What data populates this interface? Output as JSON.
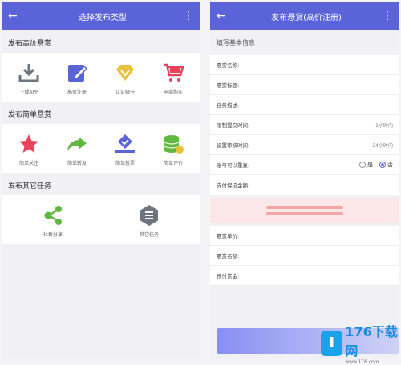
{
  "left": {
    "title": "选择发布类型",
    "sections": [
      {
        "title": "发布高价悬赏",
        "items": [
          {
            "label": "下载APP",
            "icon": "download-icon"
          },
          {
            "label": "高价注册",
            "icon": "edit-icon"
          },
          {
            "label": "认证绑卡",
            "icon": "diamond-icon"
          },
          {
            "label": "电商购买",
            "icon": "cart-icon"
          }
        ]
      },
      {
        "title": "发布简单悬赏",
        "items": [
          {
            "label": "简单关注",
            "icon": "star-icon"
          },
          {
            "label": "简单转发",
            "icon": "share-arrow-icon"
          },
          {
            "label": "简单投票",
            "icon": "vote-icon"
          },
          {
            "label": "简单评价",
            "icon": "database-icon"
          }
        ]
      },
      {
        "title": "发布其它任务",
        "items": [
          {
            "label": "社群分享",
            "icon": "share-nodes-icon"
          },
          {
            "label": "其它任务",
            "icon": "list-icon"
          }
        ]
      }
    ]
  },
  "right": {
    "title": "发布悬赏(高价注册)",
    "section_title": "填写基本信息",
    "fields": [
      {
        "label": "悬赏名称:"
      },
      {
        "label": "悬赏标题:"
      },
      {
        "label": "任务描述:"
      },
      {
        "label": "限制提交时间:",
        "value": "1小时内"
      },
      {
        "label": "设置审核时间:",
        "value": "24小时内"
      },
      {
        "label": "账号可以重复:"
      },
      {
        "label": "支付保证金额:"
      }
    ],
    "radio": {
      "yes": "是",
      "no": "否"
    },
    "fields2": [
      {
        "label": "悬赏单价:"
      },
      {
        "label": "悬赏名额:"
      },
      {
        "label": "预付赏金:"
      }
    ]
  },
  "watermark": {
    "logo": "I",
    "name": "176下载网",
    "url": "www.176.com"
  },
  "colors": {
    "primary": "#5b63d9",
    "red": "#e8435a",
    "green": "#5fb83f",
    "yellow": "#e9c23c",
    "purple": "#5b63d9",
    "gray": "#6d7680"
  }
}
